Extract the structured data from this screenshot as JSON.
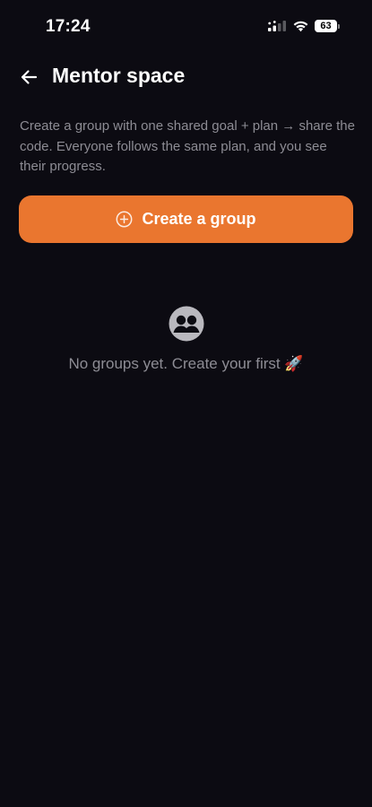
{
  "status_bar": {
    "time": "17:24",
    "battery_level": "63",
    "icons": [
      "signal-icon",
      "wifi-icon",
      "battery-icon"
    ]
  },
  "header": {
    "back_icon": "back-arrow-icon",
    "title": "Mentor space"
  },
  "description": "Create a group with one shared goal + plan → share the code. Everyone follows the same plan, and you see their progress.",
  "create_button": {
    "icon": "plus-circle-icon",
    "label": "Create a group"
  },
  "empty_state": {
    "icon": "group-icon",
    "text": "No groups yet. Create your first 🚀"
  },
  "colors": {
    "background": "#0c0b12",
    "accent": "#ea762f",
    "muted_text": "#8d8c94",
    "text": "#ffffff"
  }
}
